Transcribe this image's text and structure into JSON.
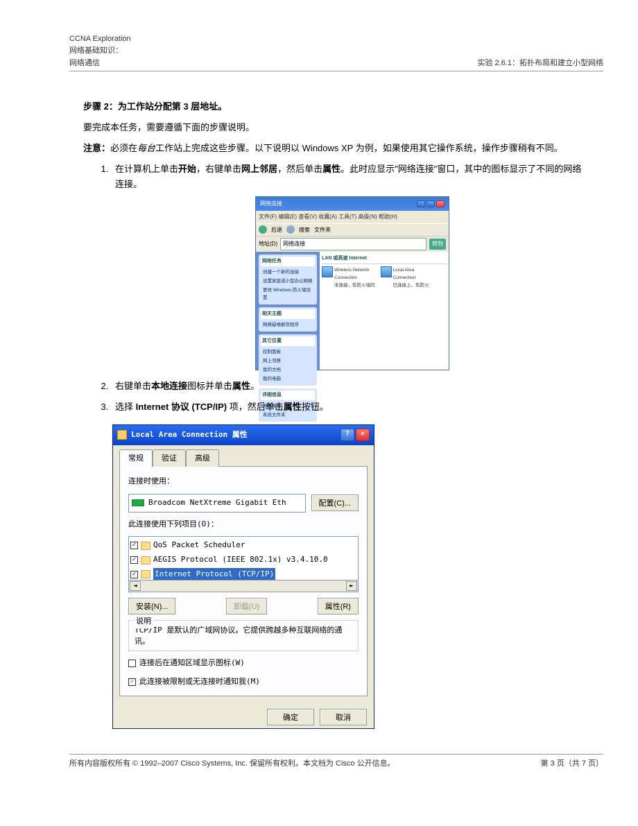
{
  "header": {
    "line1": "CCNA Exploration",
    "line2": "网络基础知识：",
    "line3": "网络通信",
    "right": "实验 2.6.1：拓扑布局和建立小型网络"
  },
  "step": {
    "title": "步骤 2：为工作站分配第 3 层地址。",
    "intro": "要完成本任务，需要遵循下面的步骤说明。",
    "note_label": "注意：",
    "note_pre": "必须在",
    "note_em": "每台",
    "note_post": "工作站上完成这些步骤。以下说明以 Windows XP 为例，如果使用其它操作系统，操作步骤稍有不同。",
    "items": [
      {
        "pre": "在计算机上单击",
        "b1": "开始",
        "mid1": "，右键单击",
        "b2": "网上邻居",
        "mid2": "，然后单击",
        "b3": "属性",
        "post": "。此时应显示\"网络连接\"窗口，其中的图标显示了不同的网络连接。"
      },
      {
        "pre": "右键单击",
        "b1": "本地连接",
        "mid1": "图标并单击",
        "b2": "属性",
        "post": "。"
      },
      {
        "pre": "选择 ",
        "b1": "Internet 协议 (TCP/IP)",
        "mid1": " 项，然后单击",
        "b2": "属性",
        "post": "按钮。"
      }
    ]
  },
  "shot1": {
    "title": "网络连接",
    "menu": "文件(F)  编辑(E)  查看(V)  收藏(A)  工具(T)  高级(N)  帮助(H)",
    "back": "后退",
    "search": "搜索",
    "folders": "文件夹",
    "addr_lbl": "地址(D)",
    "addr_val": "网络连接",
    "go": "转到",
    "section": "LAN 或高速 Internet",
    "conn1": {
      "l1": "Wireless Network",
      "l2": "Connection",
      "l3": "未连接，有防火墙的"
    },
    "conn2": {
      "l1": "Local Area",
      "l2": "Connection",
      "l3": "已连接上，有防火"
    },
    "boxes": [
      {
        "hd": "网络任务",
        "its": [
          "创建一个新的连接",
          "设置家庭或小型办公网络",
          "更改 Windows 防火墙设置"
        ]
      },
      {
        "hd": "相关主题",
        "its": [
          "网络疑难解答程序"
        ]
      },
      {
        "hd": "其它位置",
        "its": [
          "控制面板",
          "网上邻居",
          "我的文档",
          "我的电脑"
        ]
      },
      {
        "hd": "详细信息",
        "its": [
          "网络连接",
          "系统文件夹"
        ]
      }
    ]
  },
  "shot2": {
    "title": "Local Area Connection 属性",
    "help": "?",
    "close": "×",
    "tabs": [
      "常规",
      "验证",
      "高级"
    ],
    "conn_label": "连接时使用：",
    "adapter": "Broadcom NetXtreme Gigabit Eth",
    "config_btn": "配置(C)...",
    "uses_label": "此连接使用下列项目(O)：",
    "list": [
      {
        "chk": "✓",
        "txt": "QoS Packet Scheduler"
      },
      {
        "chk": "✓",
        "txt": "AEGIS Protocol (IEEE 802.1x) v3.4.10.0"
      },
      {
        "chk": "✓",
        "txt": "Internet Protocol (TCP/IP)",
        "sel": true
      }
    ],
    "install_btn": "安装(N)...",
    "uninstall_btn": "卸载(U)",
    "props_btn": "属性(R)",
    "desc_label": "说明",
    "desc": "TCP/IP 是默认的广域网协议。它提供跨越多种互联网络的通讯。",
    "chk1": "连接后在通知区域显示图标(W)",
    "chk2": "此连接被限制或无连接时通知我(M)",
    "ok": "确定",
    "cancel": "取消"
  },
  "footer": {
    "left": "所有内容版权所有 © 1992–2007 Cisco Systems, Inc. 保留所有权利。本文档为 Cisco 公开信息。",
    "right": "第 3 页（共 7 页）"
  }
}
